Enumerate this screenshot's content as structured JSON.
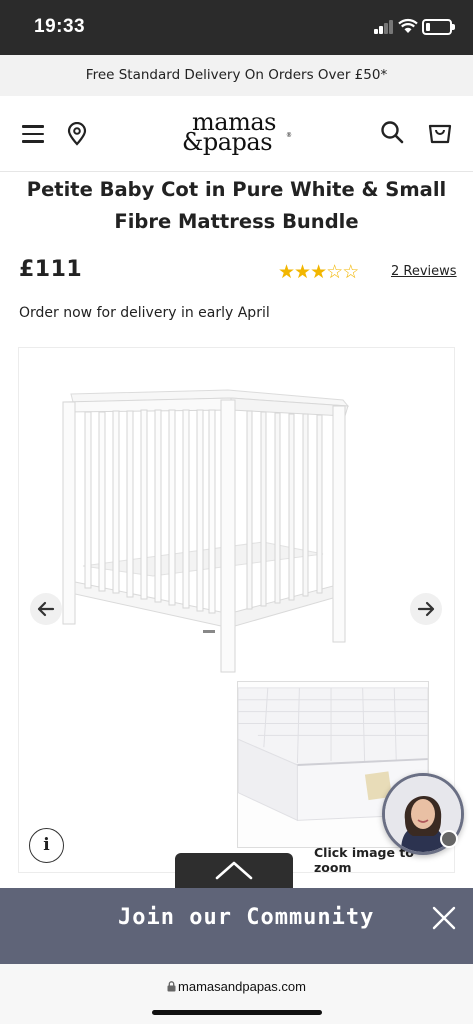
{
  "status_bar": {
    "time": "19:33",
    "battery_level": 0.2
  },
  "promo": {
    "text": "Free Standard Delivery On Orders Over £50*"
  },
  "header": {
    "logo_line1": "mamas",
    "logo_line2": "&papas",
    "logo_mark": "®",
    "icons": [
      "menu-icon",
      "location-pin-icon",
      "search-icon",
      "shopping-bag-icon"
    ]
  },
  "product": {
    "title": "Petite Baby Cot in Pure White & Small Fibre Mattress Bundle",
    "price": "£111",
    "rating": 3,
    "rating_max": 5,
    "reviews_label": "2 Reviews",
    "delivery_note": "Order now for delivery in early April"
  },
  "gallery": {
    "zoom_hint": "Click image to zoom",
    "info_label": "i"
  },
  "community": {
    "label": "Join our Community"
  },
  "browser": {
    "url": "mamasandpapas.com"
  },
  "colors": {
    "star": "#f2b600",
    "community_bar": "#5f6478",
    "status_bar": "#2b2b2b"
  }
}
